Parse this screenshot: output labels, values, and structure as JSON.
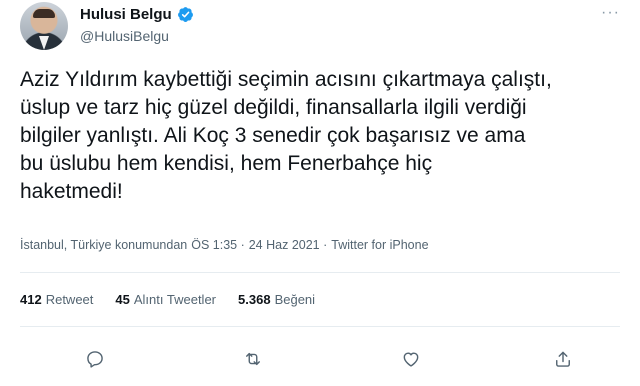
{
  "author": {
    "name": "Hulusi Belgu",
    "handle": "@HulusiBelgu"
  },
  "menu": {
    "more_label": "···"
  },
  "tweet": {
    "text": "Aziz Yıldırım kaybettiği seçimin acısını çıkartmaya çalıştı,\nüslup ve tarz hiç güzel değildi, finansallarla ilgili verdiği\nbilgiler yanlıştı. Ali Koç 3 senedir çok başarısız ve  ama\nbu üslubu hem kendisi, hem Fenerbahçe  hiç\nhaketmedi!"
  },
  "meta": {
    "location": "İstanbul, Türkiye konumundan",
    "sep1": "ÖS 1:35 ·",
    "date": "24 Haz 2021 ·",
    "client": "Twitter for iPhone"
  },
  "stats": {
    "retweets": {
      "count": "412",
      "label": "Retweet"
    },
    "quotes": {
      "count": "45",
      "label": "Alıntı Tweetler"
    },
    "likes": {
      "count": "5.368",
      "label": "Beğeni"
    }
  },
  "icons": {
    "reply": "reply-icon",
    "retweet": "retweet-icon",
    "like": "heart-icon",
    "share": "share-icon",
    "verified": "verified-badge-icon"
  },
  "colors": {
    "verified": "#1d9bf0",
    "text": "#0f1419",
    "secondary": "#536471",
    "divider": "#e6ecf0"
  }
}
